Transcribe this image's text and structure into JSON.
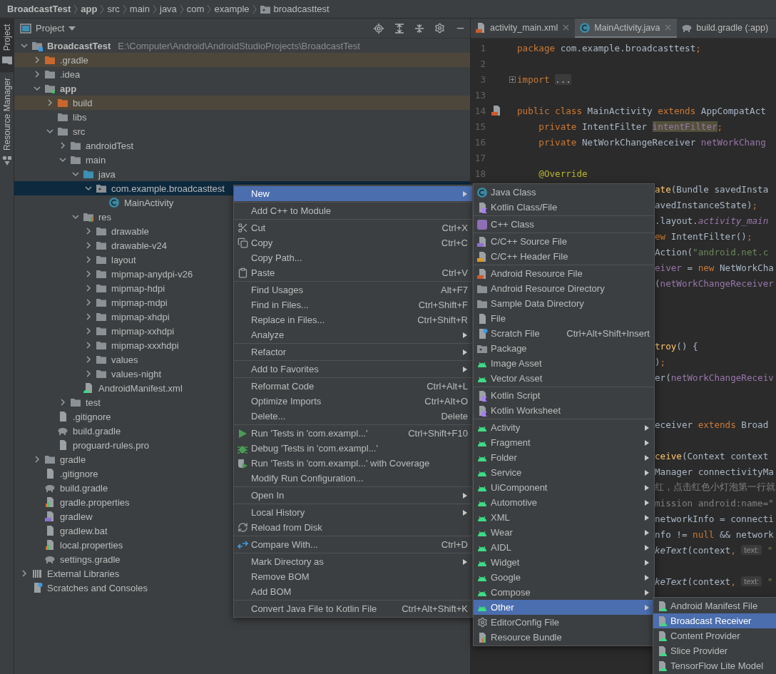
{
  "breadcrumbs": [
    {
      "label": "BroadcastTest",
      "kind": "module"
    },
    {
      "label": "app",
      "kind": "module"
    },
    {
      "label": "src",
      "kind": "folder"
    },
    {
      "label": "main",
      "kind": "folder"
    },
    {
      "label": "java",
      "kind": "folder"
    },
    {
      "label": "com",
      "kind": "folder"
    },
    {
      "label": "example",
      "kind": "folder"
    },
    {
      "label": "broadcasttest",
      "kind": "package"
    }
  ],
  "tool_strip": [
    {
      "label": "Project",
      "kind": "project",
      "selected": true
    },
    {
      "label": "Resource Manager",
      "kind": "resources",
      "selected": false
    }
  ],
  "project_panel": {
    "title": "Project",
    "tree": [
      {
        "label": "BroadcastTest",
        "kind": "root",
        "path": "E:\\Computer\\Android\\AndroidStudioProjects\\BroadcastTest",
        "expanded": true,
        "selected": false,
        "children": [
          {
            "label": ".gradle",
            "kind": "excluded",
            "expanded": false,
            "selected": false
          },
          {
            "label": ".idea",
            "kind": "folder",
            "expanded": false,
            "selected": false
          },
          {
            "label": "app",
            "kind": "module",
            "expanded": true,
            "selected": false,
            "children": [
              {
                "label": "build",
                "kind": "excluded",
                "expanded": false,
                "selected": false
              },
              {
                "label": "libs",
                "kind": "folder",
                "selected": false
              },
              {
                "label": "src",
                "kind": "folder",
                "expanded": true,
                "selected": false,
                "children": [
                  {
                    "label": "androidTest",
                    "kind": "folder",
                    "expanded": false,
                    "selected": false
                  },
                  {
                    "label": "main",
                    "kind": "folder",
                    "expanded": true,
                    "selected": false,
                    "children": [
                      {
                        "label": "java",
                        "kind": "source",
                        "expanded": true,
                        "selected": false,
                        "children": [
                          {
                            "label": "com.example.broadcasttest",
                            "kind": "package",
                            "expanded": true,
                            "selected": true,
                            "children": [
                              {
                                "label": "MainActivity",
                                "kind": "class",
                                "selected": false
                              }
                            ]
                          }
                        ]
                      },
                      {
                        "label": "res",
                        "kind": "res",
                        "expanded": true,
                        "selected": false,
                        "children": [
                          {
                            "label": "drawable",
                            "kind": "folder",
                            "expanded": false,
                            "selected": false
                          },
                          {
                            "label": "drawable-v24",
                            "kind": "folder",
                            "expanded": false,
                            "selected": false
                          },
                          {
                            "label": "layout",
                            "kind": "folder",
                            "expanded": false,
                            "selected": false
                          },
                          {
                            "label": "mipmap-anydpi-v26",
                            "kind": "folder",
                            "expanded": false,
                            "selected": false
                          },
                          {
                            "label": "mipmap-hdpi",
                            "kind": "folder",
                            "expanded": false,
                            "selected": false
                          },
                          {
                            "label": "mipmap-mdpi",
                            "kind": "folder",
                            "expanded": false,
                            "selected": false
                          },
                          {
                            "label": "mipmap-xhdpi",
                            "kind": "folder",
                            "expanded": false,
                            "selected": false
                          },
                          {
                            "label": "mipmap-xxhdpi",
                            "kind": "folder",
                            "expanded": false,
                            "selected": false
                          },
                          {
                            "label": "mipmap-xxxhdpi",
                            "kind": "folder",
                            "expanded": false,
                            "selected": false
                          },
                          {
                            "label": "values",
                            "kind": "folder",
                            "expanded": false,
                            "selected": false
                          },
                          {
                            "label": "values-night",
                            "kind": "folder",
                            "expanded": false,
                            "selected": false
                          }
                        ]
                      },
                      {
                        "label": "AndroidManifest.xml",
                        "kind": "manifest",
                        "selected": false
                      }
                    ]
                  },
                  {
                    "label": "test",
                    "kind": "folder",
                    "expanded": false,
                    "selected": false
                  }
                ]
              },
              {
                "label": ".gitignore",
                "kind": "ignore",
                "selected": false
              },
              {
                "label": "build.gradle",
                "kind": "gradle",
                "selected": false
              },
              {
                "label": "proguard-rules.pro",
                "kind": "text",
                "selected": false
              }
            ]
          },
          {
            "label": "gradle",
            "kind": "folder",
            "expanded": false,
            "selected": false
          },
          {
            "label": ".gitignore",
            "kind": "ignore",
            "selected": false
          },
          {
            "label": "build.gradle",
            "kind": "gradle",
            "selected": false
          },
          {
            "label": "gradle.properties",
            "kind": "properties",
            "selected": false
          },
          {
            "label": "gradlew",
            "kind": "script",
            "selected": false
          },
          {
            "label": "gradlew.bat",
            "kind": "text",
            "selected": false
          },
          {
            "label": "local.properties",
            "kind": "properties",
            "selected": false
          },
          {
            "label": "settings.gradle",
            "kind": "gradle",
            "selected": false
          }
        ]
      },
      {
        "label": "External Libraries",
        "kind": "libraries",
        "expanded": false,
        "selected": false
      },
      {
        "label": "Scratches and Consoles",
        "kind": "scratches",
        "selected": false
      }
    ]
  },
  "editor": {
    "tabs": [
      {
        "label": "activity_main.xml",
        "kind": "xml",
        "selected": false,
        "closable": true
      },
      {
        "label": "MainActivity.java",
        "kind": "class",
        "selected": true,
        "closable": true
      },
      {
        "label": "build.gradle (:app)",
        "kind": "gradle",
        "selected": false,
        "closable": false
      }
    ],
    "lines": [
      {
        "number": "1",
        "segments": [
          {
            "kind": "keyword",
            "text": "package "
          },
          {
            "kind": "plain",
            "text": "com.example.broadcasttest"
          },
          {
            "kind": "keyword",
            "text": ";"
          }
        ]
      },
      {
        "number": "2"
      },
      {
        "number": "3",
        "folded": true,
        "segments": [
          {
            "kind": "keyword",
            "text": "import "
          },
          {
            "kind": "folded",
            "text": "..."
          }
        ]
      },
      {
        "number": "13"
      },
      {
        "number": "14",
        "gutter_marker": true,
        "segments": [
          {
            "kind": "keyword",
            "text": "public class "
          },
          {
            "kind": "plain",
            "text": "MainActivity "
          },
          {
            "kind": "keyword",
            "text": "extends "
          },
          {
            "kind": "plain",
            "text": "AppCompatAct"
          }
        ]
      },
      {
        "number": "15",
        "segments": [
          {
            "kind": "keyword",
            "text": "    private "
          },
          {
            "kind": "plain",
            "text": "IntentFilter "
          },
          {
            "kind": "usage",
            "text": "intentFilter"
          },
          {
            "kind": "keyword",
            "text": ";"
          }
        ]
      },
      {
        "number": "16",
        "segments": [
          {
            "kind": "keyword",
            "text": "    private "
          },
          {
            "kind": "plain",
            "text": "NetWorkChangeReceiver "
          },
          {
            "kind": "field",
            "text": "netWorkChang"
          }
        ]
      },
      {
        "number": "17"
      },
      {
        "number": "18",
        "segments": [
          {
            "kind": "annotation",
            "text": "    @Override"
          }
        ]
      },
      {
        "covered": true,
        "segments": [
          {
            "kind": "method",
            "text": "ate"
          },
          {
            "kind": "plain",
            "text": "(Bundle savedInsta"
          }
        ]
      },
      {
        "covered": true,
        "segments": [
          {
            "kind": "plain",
            "text": "avedInstanceState)"
          },
          {
            "kind": "keyword",
            "text": ";"
          }
        ]
      },
      {
        "covered": true,
        "segments": [
          {
            "kind": "plain",
            "text": ".layout."
          },
          {
            "kind": "static",
            "text": "activity_main"
          }
        ]
      },
      {
        "covered": true,
        "segments": [
          {
            "kind": "keyword",
            "text": "ew "
          },
          {
            "kind": "plain",
            "text": "IntentFilter()"
          },
          {
            "kind": "keyword",
            "text": ";"
          }
        ]
      },
      {
        "covered": true,
        "segments": [
          {
            "kind": "plain",
            "text": "Action("
          },
          {
            "kind": "string",
            "text": "\"android.net.c"
          }
        ]
      },
      {
        "covered": true,
        "segments": [
          {
            "kind": "field",
            "text": "eiver"
          },
          {
            "kind": "plain",
            "text": " = "
          },
          {
            "kind": "keyword",
            "text": "new "
          },
          {
            "kind": "plain",
            "text": "NetWorkCha"
          }
        ]
      },
      {
        "covered": true,
        "segments": [
          {
            "kind": "plain",
            "text": "("
          },
          {
            "kind": "field",
            "text": "netWorkChangeReceiver"
          }
        ]
      },
      {
        "covered": true
      },
      {
        "covered": true
      },
      {
        "covered": true
      },
      {
        "covered": true,
        "segments": [
          {
            "kind": "method",
            "text": "troy"
          },
          {
            "kind": "plain",
            "text": "() {"
          }
        ]
      },
      {
        "covered": true,
        "segments": [
          {
            "kind": "plain",
            "text": ")"
          },
          {
            "kind": "keyword",
            "text": ";"
          }
        ]
      },
      {
        "covered": true,
        "segments": [
          {
            "kind": "plain",
            "text": "er("
          },
          {
            "kind": "field",
            "text": "netWorkChangeReceiv"
          }
        ]
      },
      {
        "covered": true
      },
      {
        "covered": true
      },
      {
        "covered": true,
        "segments": [
          {
            "kind": "plain",
            "text": "eceiver "
          },
          {
            "kind": "keyword",
            "text": "extends "
          },
          {
            "kind": "plain",
            "text": "Broad"
          }
        ]
      },
      {
        "covered": true
      },
      {
        "covered": true,
        "segments": [
          {
            "kind": "method",
            "text": "ceive"
          },
          {
            "kind": "plain",
            "text": "(Context context"
          }
        ]
      },
      {
        "covered": true,
        "segments": [
          {
            "kind": "plain",
            "text": "Manager connectivityMa"
          }
        ]
      },
      {
        "covered": true,
        "segments": [
          {
            "kind": "comment",
            "text": "红，点击红色小灯泡第一行就"
          }
        ]
      },
      {
        "covered": true,
        "segments": [
          {
            "kind": "comment",
            "text": "mission android:name=\""
          }
        ]
      },
      {
        "covered": true,
        "segments": [
          {
            "kind": "plain",
            "text": "networkInfo = connecti"
          }
        ]
      },
      {
        "covered": true,
        "segments": [
          {
            "kind": "plain",
            "text": "nfo != "
          },
          {
            "kind": "keyword",
            "text": "null "
          },
          {
            "kind": "plain",
            "text": "&& network"
          }
        ]
      },
      {
        "covered": true,
        "segments": [
          {
            "kind": "static-call",
            "text": "keText"
          },
          {
            "kind": "plain",
            "text": "(context"
          },
          {
            "kind": "keyword",
            "text": ", "
          },
          {
            "kind": "hint",
            "text": "text:"
          },
          {
            "kind": "string",
            "text": " \""
          }
        ]
      },
      {
        "covered": true
      },
      {
        "covered": true,
        "segments": [
          {
            "kind": "static-call",
            "text": "keText"
          },
          {
            "kind": "plain",
            "text": "(context"
          },
          {
            "kind": "keyword",
            "text": ", "
          },
          {
            "kind": "hint",
            "text": "text:"
          },
          {
            "kind": "string",
            "text": " \""
          }
        ]
      }
    ]
  },
  "context_menu": {
    "groups": [
      {
        "items": [
          {
            "label": "New",
            "submenu": true,
            "selected": true
          }
        ]
      },
      {
        "items": [
          {
            "label": "Add C++ to Module",
            "selected": false
          }
        ]
      },
      {
        "items": [
          {
            "label": "Cut",
            "kind": "cut",
            "shortcut": "Ctrl+X",
            "selected": false
          },
          {
            "label": "Copy",
            "kind": "copy",
            "shortcut": "Ctrl+C",
            "selected": false
          },
          {
            "label": "Copy Path...",
            "selected": false
          },
          {
            "label": "Paste",
            "kind": "paste",
            "shortcut": "Ctrl+V",
            "selected": false
          }
        ]
      },
      {
        "items": [
          {
            "label": "Find Usages",
            "shortcut": "Alt+F7",
            "selected": false
          },
          {
            "label": "Find in Files...",
            "shortcut": "Ctrl+Shift+F",
            "selected": false
          },
          {
            "label": "Replace in Files...",
            "shortcut": "Ctrl+Shift+R",
            "selected": false
          },
          {
            "label": "Analyze",
            "submenu": true,
            "selected": false
          }
        ]
      },
      {
        "items": [
          {
            "label": "Refactor",
            "submenu": true,
            "selected": false
          }
        ]
      },
      {
        "items": [
          {
            "label": "Add to Favorites",
            "submenu": true,
            "selected": false
          }
        ]
      },
      {
        "items": [
          {
            "label": "Reformat Code",
            "shortcut": "Ctrl+Alt+L",
            "selected": false
          },
          {
            "label": "Optimize Imports",
            "shortcut": "Ctrl+Alt+O",
            "selected": false
          },
          {
            "label": "Delete...",
            "shortcut": "Delete",
            "selected": false
          }
        ]
      },
      {
        "items": [
          {
            "label": "Run 'Tests in 'com.exampl...'",
            "kind": "run",
            "shortcut": "Ctrl+Shift+F10",
            "selected": false
          },
          {
            "label": "Debug 'Tests in 'com.exampl...'",
            "kind": "debug",
            "selected": false
          },
          {
            "label": "Run 'Tests in 'com.exampl...' with Coverage",
            "kind": "coverage",
            "selected": false
          },
          {
            "label": "Modify Run Configuration...",
            "selected": false
          }
        ]
      },
      {
        "items": [
          {
            "label": "Open In",
            "submenu": true,
            "selected": false
          }
        ]
      },
      {
        "items": [
          {
            "label": "Local History",
            "submenu": true,
            "selected": false
          },
          {
            "label": "Reload from Disk",
            "kind": "reload",
            "selected": false
          }
        ]
      },
      {
        "items": [
          {
            "label": "Compare With...",
            "kind": "compare",
            "shortcut": "Ctrl+D",
            "selected": false
          }
        ]
      },
      {
        "items": [
          {
            "label": "Mark Directory as",
            "submenu": true,
            "selected": false
          },
          {
            "label": "Remove BOM",
            "selected": false
          },
          {
            "label": "Add BOM",
            "selected": false
          }
        ]
      },
      {
        "items": [
          {
            "label": "Convert Java File to Kotlin File",
            "shortcut": "Ctrl+Alt+Shift+K",
            "selected": false
          }
        ]
      }
    ]
  },
  "new_submenu": {
    "groups": [
      {
        "items": [
          {
            "label": "Java Class",
            "kind": "class",
            "selected": false
          },
          {
            "label": "Kotlin Class/File",
            "kind": "kotlin",
            "selected": false
          }
        ]
      },
      {
        "items": [
          {
            "label": "C++ Class",
            "kind": "cpp-class",
            "selected": false
          }
        ]
      },
      {
        "items": [
          {
            "label": "C/C++ Source File",
            "kind": "cpp-source",
            "selected": false
          },
          {
            "label": "C/C++ Header File",
            "kind": "cpp-header",
            "selected": false
          }
        ]
      },
      {
        "items": [
          {
            "label": "Android Resource File",
            "kind": "resource-file",
            "selected": false
          },
          {
            "label": "Android Resource Directory",
            "kind": "folder",
            "selected": false
          },
          {
            "label": "Sample Data Directory",
            "kind": "folder",
            "selected": false
          },
          {
            "label": "File",
            "kind": "file",
            "selected": false
          },
          {
            "label": "Scratch File",
            "kind": "scratch",
            "shortcut": "Ctrl+Alt+Shift+Insert",
            "selected": false
          },
          {
            "label": "Package",
            "kind": "package",
            "selected": false
          },
          {
            "label": "Image Asset",
            "kind": "android",
            "selected": false
          },
          {
            "label": "Vector Asset",
            "kind": "android",
            "selected": false
          }
        ]
      },
      {
        "items": [
          {
            "label": "Kotlin Script",
            "kind": "kotlin",
            "selected": false
          },
          {
            "label": "Kotlin Worksheet",
            "kind": "kotlin",
            "selected": false
          }
        ]
      },
      {
        "items": [
          {
            "label": "Activity",
            "kind": "android",
            "submenu": true,
            "selected": false
          },
          {
            "label": "Fragment",
            "kind": "android",
            "submenu": true,
            "selected": false
          },
          {
            "label": "Folder",
            "kind": "android",
            "submenu": true,
            "selected": false
          },
          {
            "label": "Service",
            "kind": "android",
            "submenu": true,
            "selected": false
          },
          {
            "label": "UiComponent",
            "kind": "android",
            "submenu": true,
            "selected": false
          },
          {
            "label": "Automotive",
            "kind": "android",
            "submenu": true,
            "selected": false
          },
          {
            "label": "XML",
            "kind": "android",
            "submenu": true,
            "selected": false
          },
          {
            "label": "Wear",
            "kind": "android",
            "submenu": true,
            "selected": false
          },
          {
            "label": "AIDL",
            "kind": "android",
            "submenu": true,
            "selected": false
          },
          {
            "label": "Widget",
            "kind": "android",
            "submenu": true,
            "selected": false
          },
          {
            "label": "Google",
            "kind": "android",
            "submenu": true,
            "selected": false
          },
          {
            "label": "Compose",
            "kind": "android",
            "submenu": true,
            "selected": false
          },
          {
            "label": "Other",
            "kind": "android",
            "submenu": true,
            "selected": true
          },
          {
            "label": "EditorConfig File",
            "kind": "gear",
            "selected": false
          },
          {
            "label": "Resource Bundle",
            "kind": "bundle",
            "selected": false
          }
        ]
      }
    ]
  },
  "other_submenu": {
    "groups": [
      {
        "items": [
          {
            "label": "Android Manifest File",
            "kind": "android-file",
            "selected": false
          },
          {
            "label": "Broadcast Receiver",
            "kind": "android-file",
            "selected": true
          },
          {
            "label": "Content Provider",
            "kind": "android-file",
            "selected": false
          },
          {
            "label": "Slice Provider",
            "kind": "android-file",
            "selected": false
          },
          {
            "label": "TensorFlow Lite Model",
            "kind": "android-file",
            "selected": false
          }
        ]
      }
    ]
  }
}
